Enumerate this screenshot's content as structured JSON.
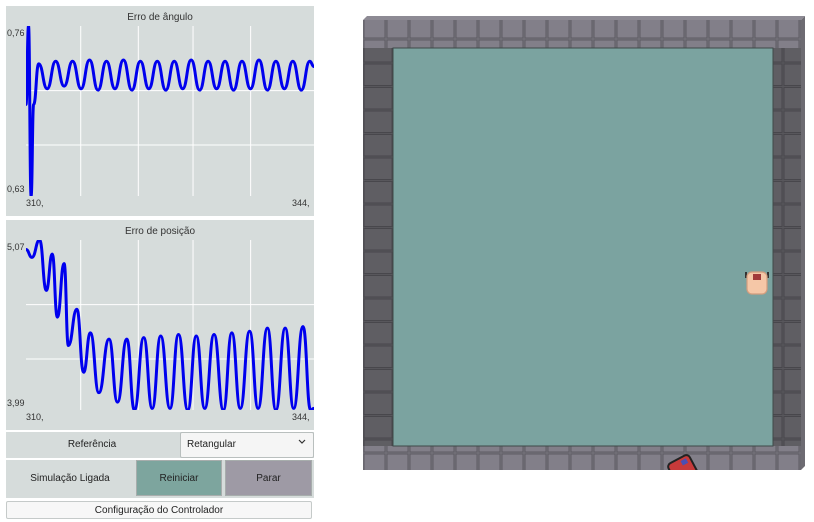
{
  "charts": {
    "angle": {
      "title": "Erro de ângulo",
      "y_max_label": "0,76",
      "y_min_label": "0,63",
      "x_start_label": "310,",
      "x_end_label": "344,"
    },
    "position": {
      "title": "Erro de posição",
      "y_max_label": "5,07",
      "y_min_label": "3,99",
      "x_start_label": "310,",
      "x_end_label": "344,"
    }
  },
  "chart_data": [
    {
      "type": "line",
      "title": "Erro de ângulo",
      "xlim": [
        310,
        344
      ],
      "ylim": [
        0.63,
        0.76
      ],
      "series": [
        {
          "x": [
            310,
            310.3,
            310.6,
            310.9,
            311.5,
            312.5,
            313.5,
            314.5,
            315.5,
            316.5,
            317.5,
            318.5,
            319.5,
            320.5,
            321.5,
            322.5,
            323.5,
            324.5,
            325.5,
            326.5,
            327.5,
            328.5,
            329.5,
            330.5,
            331.5,
            332.5,
            333.5,
            334.5,
            335.5,
            336.5,
            337.5,
            338.5,
            339.5,
            340.5,
            341.5,
            342.5,
            343.5,
            344
          ],
          "y": [
            0.7,
            0.76,
            0.63,
            0.7,
            0.731,
            0.712,
            0.733,
            0.714,
            0.733,
            0.712,
            0.734,
            0.711,
            0.733,
            0.712,
            0.734,
            0.711,
            0.733,
            0.712,
            0.733,
            0.711,
            0.733,
            0.712,
            0.734,
            0.711,
            0.733,
            0.712,
            0.733,
            0.711,
            0.733,
            0.712,
            0.734,
            0.711,
            0.733,
            0.712,
            0.733,
            0.711,
            0.733,
            0.729
          ],
          "color": "#0000ee"
        }
      ]
    },
    {
      "type": "line",
      "title": "Erro de posição",
      "xlim": [
        310,
        344
      ],
      "ylim": [
        3.99,
        5.07
      ],
      "series": [
        {
          "x": [
            310,
            310.7,
            311.6,
            312.4,
            313.1,
            313.7,
            314.5,
            315.0,
            316.0,
            316.8,
            317.6,
            318.6,
            319.8,
            320.8,
            321.9,
            322.8,
            323.9,
            324.9,
            325.9,
            327.0,
            328.0,
            329.1,
            330.1,
            331.1,
            332.2,
            333.3,
            334.3,
            335.3,
            336.4,
            337.4,
            338.5,
            339.5,
            340.6,
            341.6,
            342.7,
            343.6,
            344
          ],
          "y": [
            5.01,
            4.96,
            5.07,
            4.75,
            4.98,
            4.58,
            4.92,
            4.4,
            4.63,
            4.23,
            4.48,
            4.1,
            4.44,
            4.04,
            4.44,
            3.99,
            4.45,
            4.0,
            4.46,
            4.0,
            4.47,
            3.99,
            4.46,
            4.0,
            4.47,
            3.99,
            4.48,
            4.0,
            4.49,
            4.0,
            4.51,
            3.99,
            4.51,
            4.0,
            4.52,
            3.99,
            4.0
          ],
          "color": "#0000ee"
        }
      ]
    }
  ],
  "controls": {
    "reference_label": "Referência",
    "reference_value": "Retangular",
    "simulation_status": "Simulação Ligada",
    "restart_label": "Reiniciar",
    "stop_label": "Parar",
    "config_label": "Configuração do Controlador"
  },
  "arena": {
    "floor_color": "#7ba3a0",
    "wall_color": "#76747c",
    "robot_color": "#f5c7a7",
    "target_color": "#c73a3a"
  }
}
